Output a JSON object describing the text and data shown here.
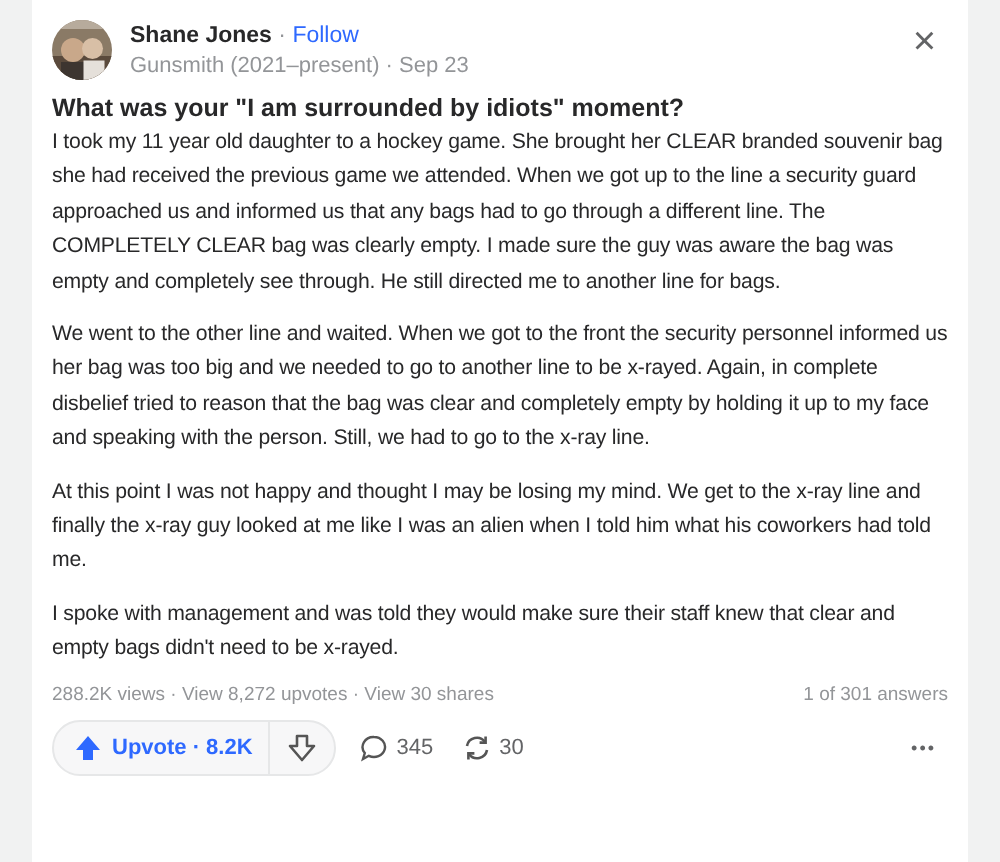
{
  "author": {
    "name": "Shane Jones",
    "follow": "Follow",
    "credential": "Gunsmith (2021–present)",
    "date": "Sep 23"
  },
  "separator": "·",
  "close": "×",
  "question": "What was your \"I am surrounded by idiots\" moment?",
  "paragraphs": [
    "I took my 11 year old daughter to a hockey game. She brought her CLEAR branded souvenir bag she had received the previous game we attended. When we got up to the line a security guard approached us and informed us that any bags had to go through a different line. The COMPLETELY CLEAR bag was clearly empty. I made sure the guy was aware the bag was empty and completely see through. He still directed me to another line for bags.",
    "We went to the other line and waited. When we got to the front the security personnel informed us her bag was too big and we needed to go to another line to be x-rayed. Again, in complete disbelief tried to reason that the bag was clear and completely empty by holding it up to my face and speaking with the person. Still, we had to go to the x-ray line.",
    "At this point I was not happy and thought I may be losing my mind. We get to the x-ray line and finally the x-ray guy looked at me like I was an alien when I told him what his coworkers had told me.",
    "I spoke with management and was told they would make sure their staff knew that clear and empty bags didn't need to be x-rayed."
  ],
  "stats": [
    "288.2K views",
    "View 8,272 upvotes",
    "View 30 shares"
  ],
  "position": "1 of 301 answers",
  "actions": {
    "upvote": "Upvote",
    "upvote_count": "8.2K",
    "comments": "345",
    "shares": "30",
    "more": "•••"
  }
}
